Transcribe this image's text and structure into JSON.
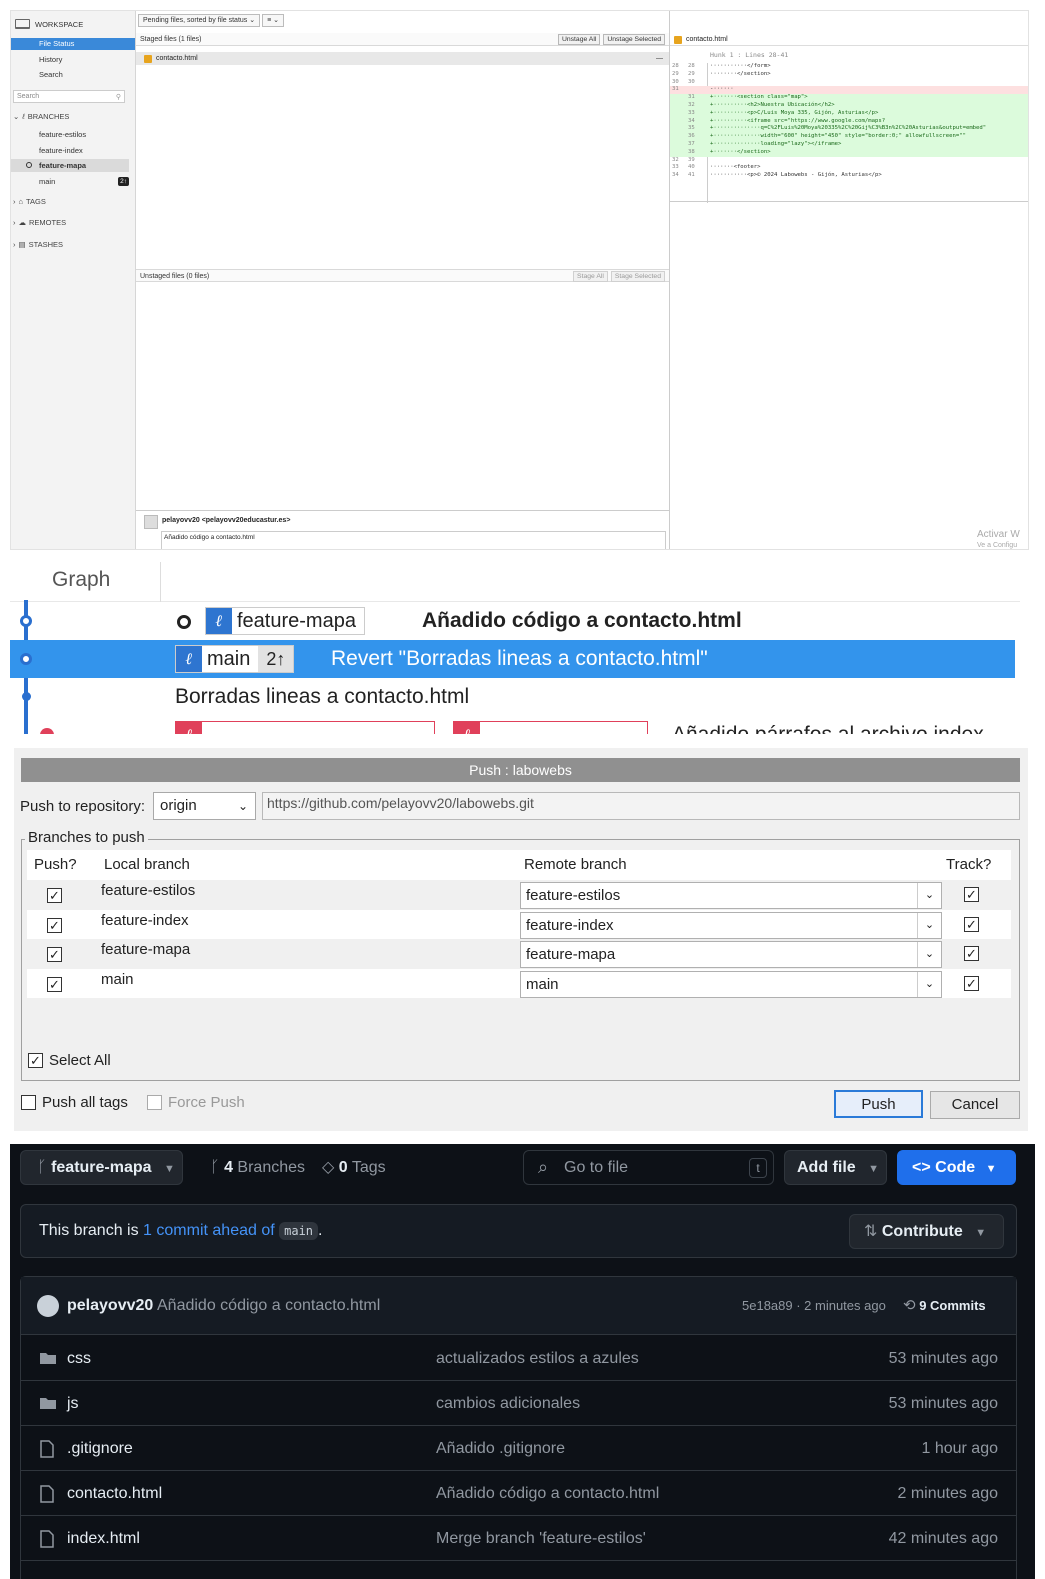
{
  "sourcetree": {
    "workspace": "WORKSPACE",
    "nav": [
      "File Status",
      "History",
      "Search"
    ],
    "search_placeholder": "Search",
    "branches_label": "BRANCHES",
    "branches": [
      "feature-estilos",
      "feature-index",
      "feature-mapa",
      "main"
    ],
    "main_badge": "2↑",
    "tags_label": "TAGS",
    "remotes_label": "REMOTES",
    "stashes_label": "STASHES",
    "pending_dropdown": "Pending files, sorted by file status",
    "list_dropdown": "≡",
    "staged_header": "Staged files  (1 files)",
    "unstage_all": "Unstage All",
    "unstage_selected": "Unstage Selected",
    "staged_file": "contacto.html",
    "unstaged_header": "Unstaged files  (0 files)",
    "stage_all": "Stage All",
    "stage_selected": "Stage Selected",
    "author": "pelayovv20 <pelayovv20educastur.es>",
    "commit_message": "Añadido código a contacto.html",
    "diff_tab": "contacto.html",
    "hunk": "Hunk 1 : Lines 28-41",
    "diff_lines": [
      {
        "n1": "28",
        "n2": "28",
        "text": "···········</form>",
        "kind": "ctx"
      },
      {
        "n1": "29",
        "n2": "29",
        "text": "········</section>",
        "kind": "ctx"
      },
      {
        "n1": "30",
        "n2": "30",
        "text": "",
        "kind": "ctx"
      },
      {
        "n1": "31",
        "n2": "",
        "text": "-······",
        "kind": "del"
      },
      {
        "n1": "",
        "n2": "31",
        "text": "+·······<section class=\"map\">",
        "kind": "add"
      },
      {
        "n1": "",
        "n2": "32",
        "text": "+··········<h2>Nuestra Ubicación</h2>",
        "kind": "add"
      },
      {
        "n1": "",
        "n2": "33",
        "text": "+··········<p>C/Luis Moya 335, Gijón, Asturias</p>",
        "kind": "add"
      },
      {
        "n1": "",
        "n2": "34",
        "text": "+··········<iframe src=\"https://www.google.com/maps?",
        "kind": "add"
      },
      {
        "n1": "",
        "n2": "35",
        "text": "+··············q=C%2FLuis%20Moya%20335%2C%20Gij%C3%B3n%2C%20Asturias&output=embed\"",
        "kind": "add"
      },
      {
        "n1": "",
        "n2": "36",
        "text": "+··············width=\"600\" height=\"450\" style=\"border:0;\" allowfullscreen=\"\"",
        "kind": "add"
      },
      {
        "n1": "",
        "n2": "37",
        "text": "+··············loading=\"lazy\"></iframe>",
        "kind": "add"
      },
      {
        "n1": "",
        "n2": "38",
        "text": "+·······</section>",
        "kind": "add"
      },
      {
        "n1": "32",
        "n2": "39",
        "text": "",
        "kind": "ctx"
      },
      {
        "n1": "33",
        "n2": "40",
        "text": "·······<footer>",
        "kind": "ctx"
      },
      {
        "n1": "34",
        "n2": "41",
        "text": "···········<p>© 2024 Labowebs - Gijón, Asturias</p>",
        "kind": "ctx"
      }
    ],
    "watermark_line1": "Activar W",
    "watermark_line2": "Ve a Configu"
  },
  "graph": {
    "header": "Graph",
    "rows": [
      {
        "branch": "feature-mapa",
        "message": "Añadido código a contacto.html"
      },
      {
        "branch": "main",
        "count": "2↑",
        "message": "Revert \"Borradas lineas a contacto.html\""
      },
      {
        "message": "Borradas lineas a contacto.html"
      },
      {
        "message": "Añadido párrafos al archivo index"
      }
    ]
  },
  "push": {
    "title": "Push : labowebs",
    "repo_label": "Push to repository:",
    "repo_value": "origin",
    "repo_url": "https://github.com/pelayovv20/labowebs.git",
    "branches_legend": "Branches to push",
    "col_push": "Push?",
    "col_local": "Local branch",
    "col_remote": "Remote branch",
    "col_track": "Track?",
    "rows": [
      {
        "local": "feature-estilos",
        "remote": "feature-estilos"
      },
      {
        "local": "feature-index",
        "remote": "feature-index"
      },
      {
        "local": "feature-mapa",
        "remote": "feature-mapa"
      },
      {
        "local": "main",
        "remote": "main"
      }
    ],
    "select_all": "Select All",
    "push_all_tags": "Push all tags",
    "force_push": "Force Push",
    "push_button": "Push",
    "cancel_button": "Cancel",
    "check_mark": "✓"
  },
  "github": {
    "branch": "feature-mapa",
    "branches_count": "4",
    "branches_label": "Branches",
    "tags_count": "0",
    "tags_label": "Tags",
    "search_placeholder": "Go to file",
    "search_key": "t",
    "add_file": "Add file",
    "code_button": "Code",
    "ahead_prefix": "This branch is",
    "ahead_link": "1 commit ahead of",
    "ahead_branch": "main",
    "ahead_suffix": ".",
    "contribute": "Contribute",
    "author": "pelayovv20",
    "last_commit_message": "Añadido código a contacto.html",
    "last_commit_meta": "5e18a89 · 2 minutes ago",
    "commits_count": "9 Commits",
    "files": [
      {
        "name": "css",
        "type": "folder",
        "message": "actualizados estilos a azules",
        "time": "53 minutes ago"
      },
      {
        "name": "js",
        "type": "folder",
        "message": "cambios adicionales",
        "time": "53 minutes ago"
      },
      {
        "name": ".gitignore",
        "type": "file",
        "message": "Añadido .gitignore",
        "time": "1 hour ago"
      },
      {
        "name": "contacto.html",
        "type": "file",
        "message": "Añadido código a contacto.html",
        "time": "2 minutes ago"
      },
      {
        "name": "index.html",
        "type": "file",
        "message": "Merge branch 'feature-estilos'",
        "time": "42 minutes ago"
      }
    ],
    "colors": {
      "bg": "#0d1117",
      "accent": "#1f6feb",
      "link": "#4493f8"
    }
  }
}
